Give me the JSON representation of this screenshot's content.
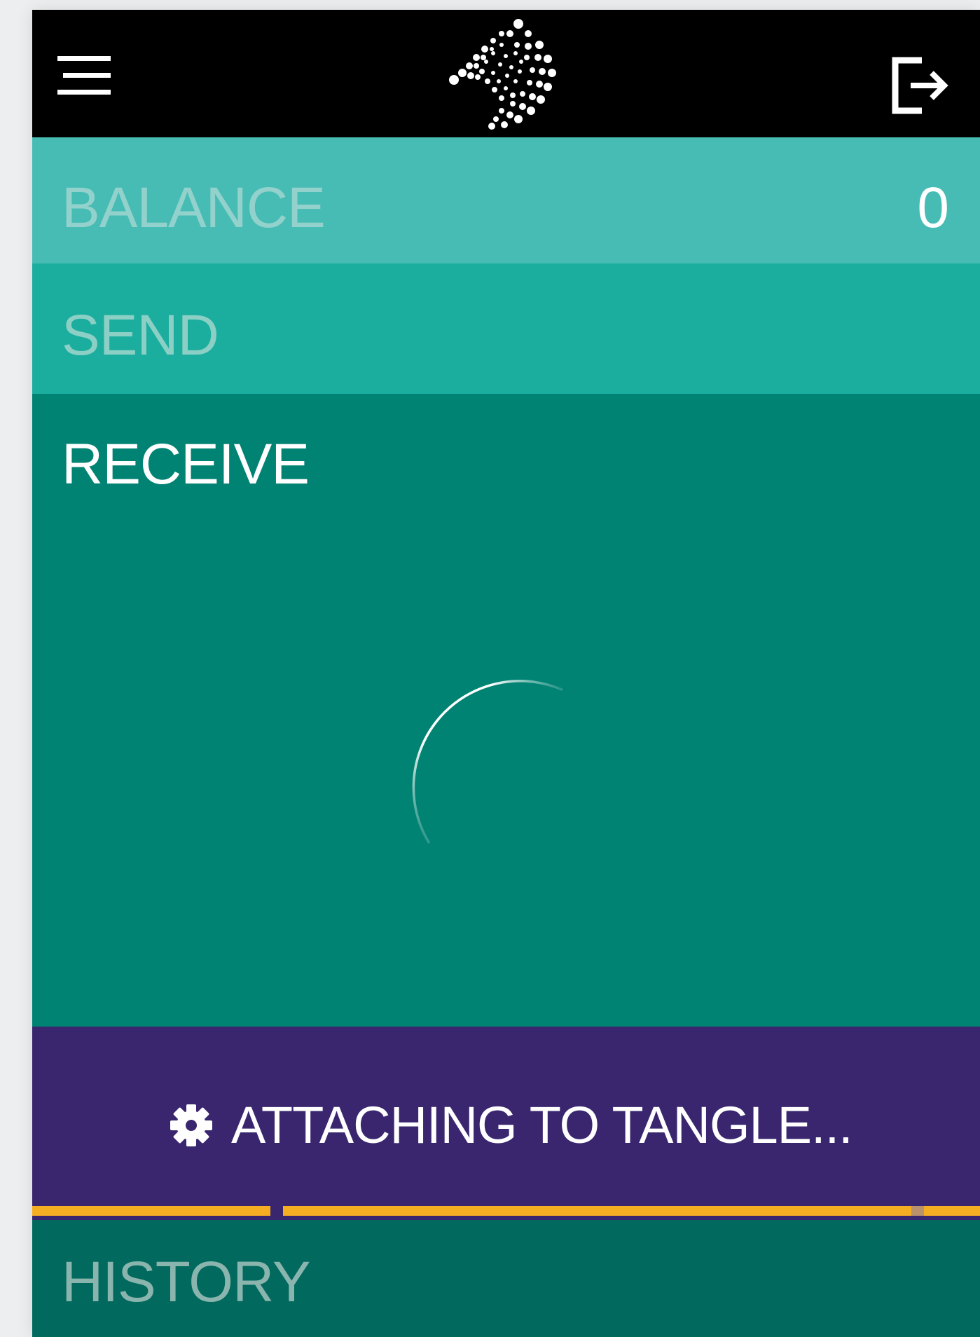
{
  "header": {
    "menu_icon": "hamburger-menu-icon",
    "logo_icon": "iota-logo",
    "logout_icon": "logout-icon"
  },
  "balance": {
    "label": "BALANCE",
    "value": "0"
  },
  "send": {
    "label": "SEND"
  },
  "receive": {
    "label": "RECEIVE",
    "loading_icon": "loading-spinner-icon"
  },
  "status": {
    "icon": "gear-icon",
    "text": "ATTACHING TO TANGLE..."
  },
  "history": {
    "label": "HISTORY"
  },
  "colors": {
    "header_bg": "#000000",
    "balance_bg": "#47bcb4",
    "send_bg": "#1bae9f",
    "receive_bg": "#018373",
    "status_bg": "#3a266f",
    "progress": "#f5ae21",
    "history_bg": "#01695d"
  }
}
